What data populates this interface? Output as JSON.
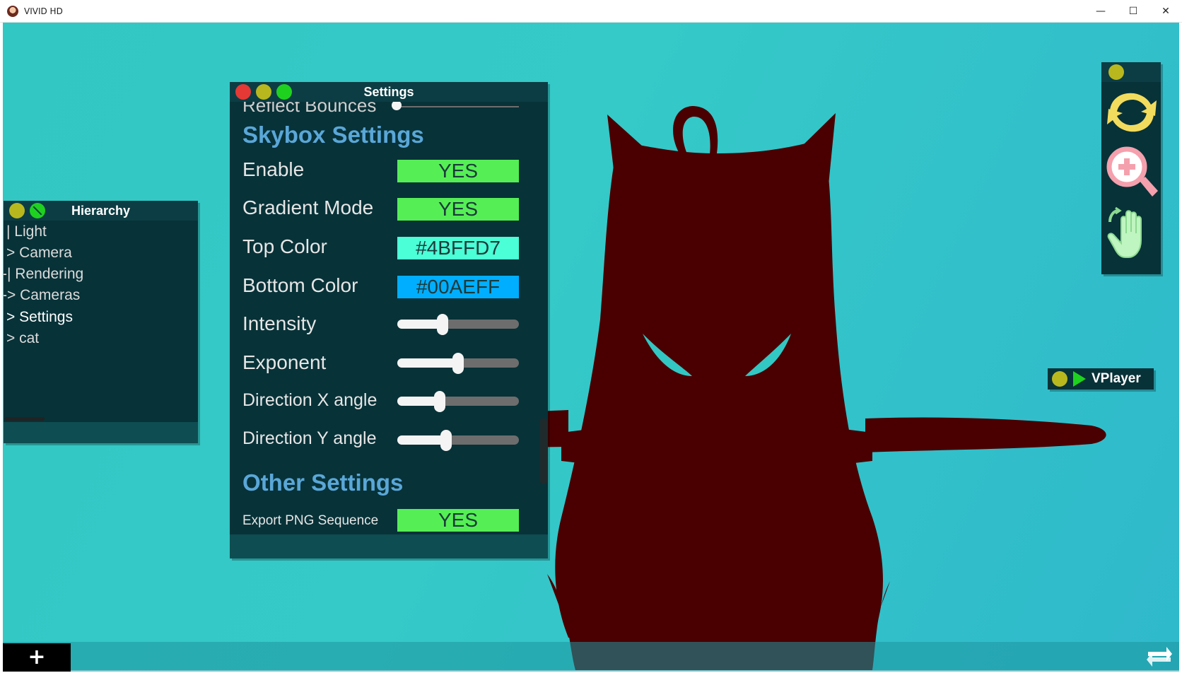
{
  "window": {
    "title": "VIVID HD",
    "minimize": "—",
    "maximize": "☐",
    "close": "✕"
  },
  "colors": {
    "viewport": "#33c7c3",
    "panel_bg": "#073238",
    "section_head": "#5aa7d8",
    "silhouette": "#4a0000",
    "yes_green": "#55ef55",
    "top_color": "#4bffd7",
    "bottom_color": "#00aeff"
  },
  "settings": {
    "title": "Settings",
    "cutoff_label": "Reflect Bounces",
    "skybox": {
      "heading": "Skybox Settings",
      "enable": {
        "label": "Enable",
        "value": "YES"
      },
      "gradient_mode": {
        "label": "Gradient Mode",
        "value": "YES"
      },
      "top_color": {
        "label": "Top Color",
        "value": "#4BFFD7"
      },
      "bottom_color": {
        "label": "Bottom Color",
        "value": "#00AEFF"
      },
      "intensity": {
        "label": "Intensity",
        "level": 0.37
      },
      "exponent": {
        "label": "Exponent",
        "level": 0.5
      },
      "direction_x": {
        "label": "Direction X angle",
        "level": 0.35
      },
      "direction_y": {
        "label": "Direction Y angle",
        "level": 0.4
      }
    },
    "other": {
      "heading": "Other Settings",
      "export_png": {
        "label": "Export PNG Sequence",
        "value": "YES"
      }
    }
  },
  "hierarchy": {
    "title": "Hierarchy",
    "items": [
      {
        "label": "| Light"
      },
      {
        "label": "> Camera"
      },
      {
        "label": "-| Rendering"
      },
      {
        "label": "-> Cameras"
      },
      {
        "label": "> Settings"
      },
      {
        "label": "> cat"
      }
    ]
  },
  "tools": {
    "items": [
      "rotate-icon",
      "zoom-in-icon",
      "pan-hand-icon"
    ]
  },
  "vplayer": {
    "label": "VPlayer"
  },
  "bottom": {
    "add_label": "+"
  }
}
